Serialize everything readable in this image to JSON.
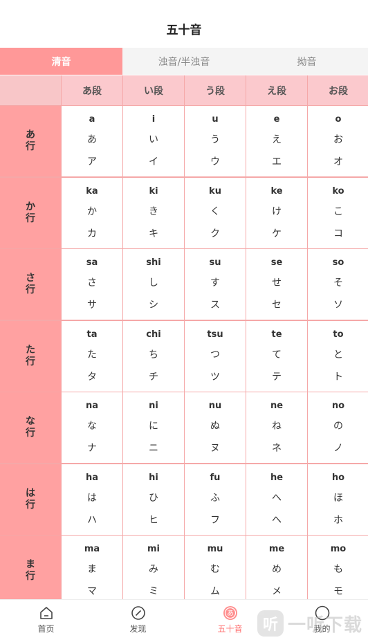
{
  "header": {
    "title": "五十音"
  },
  "tabs": [
    {
      "label": "清音",
      "active": true
    },
    {
      "label": "浊音/半浊音",
      "active": false
    },
    {
      "label": "拗音",
      "active": false
    }
  ],
  "columns": [
    "あ段",
    "い段",
    "う段",
    "え段",
    "お段"
  ],
  "rows": [
    {
      "label": [
        "あ",
        "行"
      ],
      "cells": [
        {
          "romaji": "a",
          "hira": "あ",
          "kata": "ア"
        },
        {
          "romaji": "i",
          "hira": "い",
          "kata": "イ"
        },
        {
          "romaji": "u",
          "hira": "う",
          "kata": "ウ"
        },
        {
          "romaji": "e",
          "hira": "え",
          "kata": "エ"
        },
        {
          "romaji": "o",
          "hira": "お",
          "kata": "オ"
        }
      ]
    },
    {
      "label": [
        "か",
        "行"
      ],
      "cells": [
        {
          "romaji": "ka",
          "hira": "か",
          "kata": "カ"
        },
        {
          "romaji": "ki",
          "hira": "き",
          "kata": "キ"
        },
        {
          "romaji": "ku",
          "hira": "く",
          "kata": "ク"
        },
        {
          "romaji": "ke",
          "hira": "け",
          "kata": "ケ"
        },
        {
          "romaji": "ko",
          "hira": "こ",
          "kata": "コ"
        }
      ]
    },
    {
      "label": [
        "さ",
        "行"
      ],
      "cells": [
        {
          "romaji": "sa",
          "hira": "さ",
          "kata": "サ"
        },
        {
          "romaji": "shi",
          "hira": "し",
          "kata": "シ"
        },
        {
          "romaji": "su",
          "hira": "す",
          "kata": "ス"
        },
        {
          "romaji": "se",
          "hira": "せ",
          "kata": "セ"
        },
        {
          "romaji": "so",
          "hira": "そ",
          "kata": "ソ"
        }
      ]
    },
    {
      "label": [
        "た",
        "行"
      ],
      "cells": [
        {
          "romaji": "ta",
          "hira": "た",
          "kata": "タ"
        },
        {
          "romaji": "chi",
          "hira": "ち",
          "kata": "チ"
        },
        {
          "romaji": "tsu",
          "hira": "つ",
          "kata": "ツ"
        },
        {
          "romaji": "te",
          "hira": "て",
          "kata": "テ"
        },
        {
          "romaji": "to",
          "hira": "と",
          "kata": "ト"
        }
      ]
    },
    {
      "label": [
        "な",
        "行"
      ],
      "cells": [
        {
          "romaji": "na",
          "hira": "な",
          "kata": "ナ"
        },
        {
          "romaji": "ni",
          "hira": "に",
          "kata": "ニ"
        },
        {
          "romaji": "nu",
          "hira": "ぬ",
          "kata": "ヌ"
        },
        {
          "romaji": "ne",
          "hira": "ね",
          "kata": "ネ"
        },
        {
          "romaji": "no",
          "hira": "の",
          "kata": "ノ"
        }
      ]
    },
    {
      "label": [
        "は",
        "行"
      ],
      "cells": [
        {
          "romaji": "ha",
          "hira": "は",
          "kata": "ハ"
        },
        {
          "romaji": "hi",
          "hira": "ひ",
          "kata": "ヒ"
        },
        {
          "romaji": "fu",
          "hira": "ふ",
          "kata": "フ"
        },
        {
          "romaji": "he",
          "hira": "へ",
          "kata": "へ"
        },
        {
          "romaji": "ho",
          "hira": "ほ",
          "kata": "ホ"
        }
      ]
    },
    {
      "label": [
        "ま",
        "行"
      ],
      "cells": [
        {
          "romaji": "ma",
          "hira": "ま",
          "kata": "マ"
        },
        {
          "romaji": "mi",
          "hira": "み",
          "kata": "ミ"
        },
        {
          "romaji": "mu",
          "hira": "む",
          "kata": "ム"
        },
        {
          "romaji": "me",
          "hira": "め",
          "kata": "メ"
        },
        {
          "romaji": "mo",
          "hira": "も",
          "kata": "モ"
        }
      ]
    }
  ],
  "bottom_nav": [
    {
      "label": "首页",
      "icon": "home-icon",
      "active": false
    },
    {
      "label": "发现",
      "icon": "compass-icon",
      "active": false
    },
    {
      "label": "五十音",
      "icon": "kana-icon",
      "active": true,
      "icon_glyph": "あ"
    },
    {
      "label": "我的",
      "icon": "profile-icon",
      "active": false
    }
  ],
  "watermark": {
    "badge": "听",
    "text": "一听下载"
  },
  "colors": {
    "accent": "#ff9898",
    "row_head": "#ffa1a1",
    "col_head": "#fbc9cd",
    "border": "#f5a8a8",
    "active_label": "#ff6f6f"
  }
}
